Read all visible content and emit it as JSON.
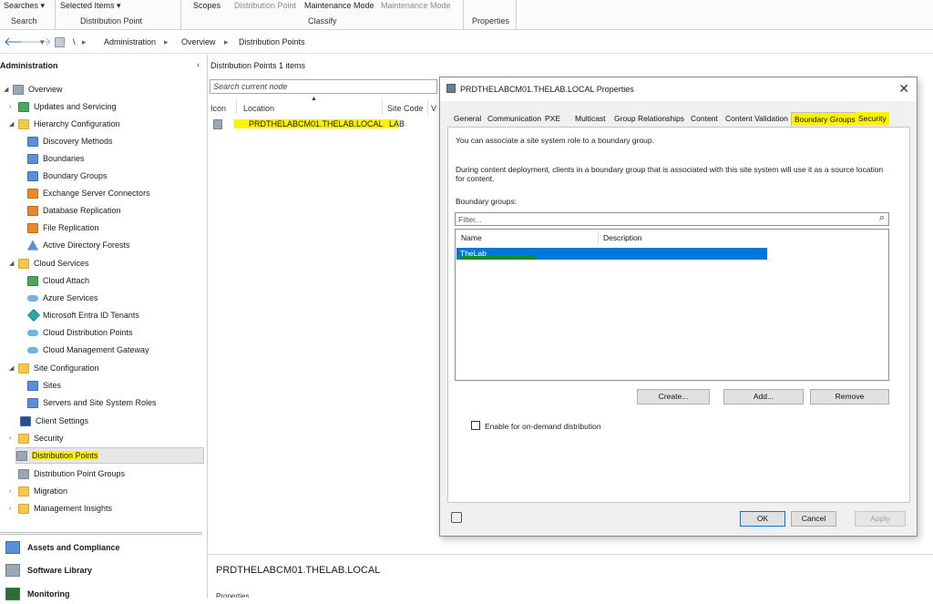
{
  "ribbon": {
    "searches": "Searches ▾",
    "selected_items": "Selected Items ▾",
    "scopes": "Scopes",
    "distribution_point": "Distribution Point",
    "maintenance_mode": "Maintenance Mode",
    "maintenance_mode_grey": "Maintenance Mode",
    "group_search": "Search",
    "group_distribution_point": "Distribution Point",
    "group_classify": "Classify",
    "group_properties": "Properties"
  },
  "address": {
    "back": "🡐",
    "forward": "🡒",
    "crumbs": [
      "\\",
      "Administration",
      "Overview",
      "Distribution Points"
    ]
  },
  "nav": {
    "header": "Administration",
    "items": [
      {
        "label": "Overview"
      },
      {
        "label": "Updates and Servicing"
      },
      {
        "label": "Hierarchy Configuration"
      },
      {
        "label": "Discovery Methods"
      },
      {
        "label": "Boundaries"
      },
      {
        "label": "Boundary Groups"
      },
      {
        "label": "Exchange Server Connectors"
      },
      {
        "label": "Database Replication"
      },
      {
        "label": "File Replication"
      },
      {
        "label": "Active Directory Forests"
      },
      {
        "label": "Cloud Services"
      },
      {
        "label": "Cloud Attach"
      },
      {
        "label": "Azure Services"
      },
      {
        "label": "Microsoft Entra ID Tenants"
      },
      {
        "label": "Cloud Distribution Points"
      },
      {
        "label": "Cloud Management Gateway"
      },
      {
        "label": "Site Configuration"
      },
      {
        "label": "Sites"
      },
      {
        "label": "Servers and Site System Roles"
      },
      {
        "label": "Client Settings"
      },
      {
        "label": "Security"
      },
      {
        "label": "Distribution Points"
      },
      {
        "label": "Distribution Point Groups"
      },
      {
        "label": "Migration"
      },
      {
        "label": "Management Insights"
      }
    ],
    "workspaces": [
      "Assets and Compliance",
      "Software Library",
      "Monitoring"
    ]
  },
  "main": {
    "title": "Distribution Points 1 items",
    "search_placeholder": "Search current node",
    "columns": [
      "Icon",
      "Location",
      "Site Code",
      "V"
    ],
    "rows": [
      {
        "location": "PRDTHELABCM01.THELAB.LOCAL",
        "site_code": "LAB"
      }
    ],
    "detail_title": "PRDTHELABCM01.THELAB.LOCAL",
    "detail_sub": "Properties"
  },
  "dialog": {
    "title": "PRDTHELABCM01.THELAB.LOCAL Properties",
    "close": "✕",
    "tabs": [
      "General",
      "Communication",
      "PXE",
      "Multicast",
      "Group Relationships",
      "Content",
      "Content Validation",
      "Boundary Groups",
      "Security"
    ],
    "active_tab": "Boundary Groups",
    "intro": "You can associate a site system role to a boundary group.",
    "desc": "During content deployment, clients in a boundary group that is associated with this site system will use it as a source location for content.",
    "boundary_label": "Boundary groups:",
    "filter_placeholder": "Filter...",
    "grid_columns": [
      "Name",
      "Description"
    ],
    "grid_rows": [
      {
        "name": "TheLab",
        "description": ""
      }
    ],
    "btn_create": "Create...",
    "btn_add": "Add...",
    "btn_remove": "Remove",
    "checkbox_label": "Enable for on-demand distribution",
    "btn_ok": "OK",
    "btn_cancel": "Cancel",
    "btn_apply": "Apply"
  }
}
